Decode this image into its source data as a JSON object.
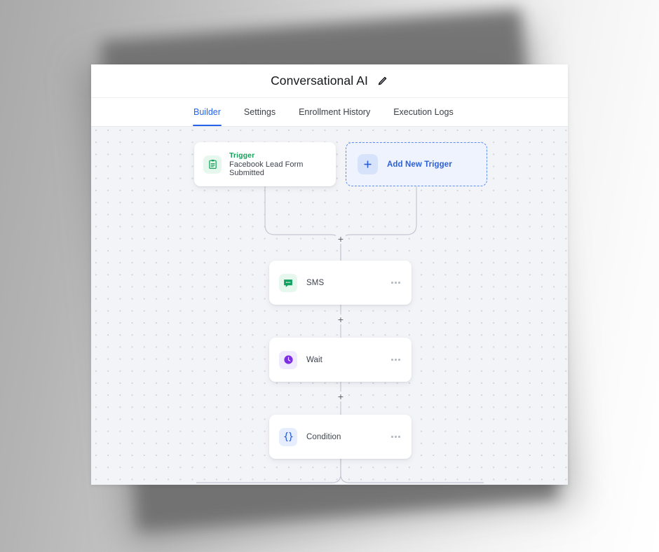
{
  "window": {
    "title": "Conversational AI",
    "edit_icon": "pencil-icon"
  },
  "tabs": [
    {
      "label": "Builder",
      "active": true
    },
    {
      "label": "Settings",
      "active": false
    },
    {
      "label": "Enrollment History",
      "active": false
    },
    {
      "label": "Execution Logs",
      "active": false
    }
  ],
  "canvas": {
    "trigger_node": {
      "icon": "clipboard-icon",
      "label": "Trigger",
      "subtitle": "Facebook Lead Form Submitted"
    },
    "add_trigger_node": {
      "icon": "plus-icon",
      "label": "Add New Trigger"
    },
    "action_nodes": [
      {
        "icon": "sms-chat-icon",
        "label": "SMS",
        "menu": "more-options-icon"
      },
      {
        "icon": "clock-icon",
        "label": "Wait",
        "menu": "more-options-icon"
      },
      {
        "icon": "braces-icon",
        "label": "Condition",
        "menu": "more-options-icon"
      }
    ],
    "add_step_buttons": [
      "+",
      "+",
      "+"
    ]
  },
  "colors": {
    "accent_blue": "#2563eb",
    "trigger_green": "#15a05b",
    "wait_purple": "#7c2fe0",
    "condition_blue": "#2c5fd6",
    "canvas_bg": "#f3f4f8",
    "edge_line": "#c3c8d2"
  }
}
